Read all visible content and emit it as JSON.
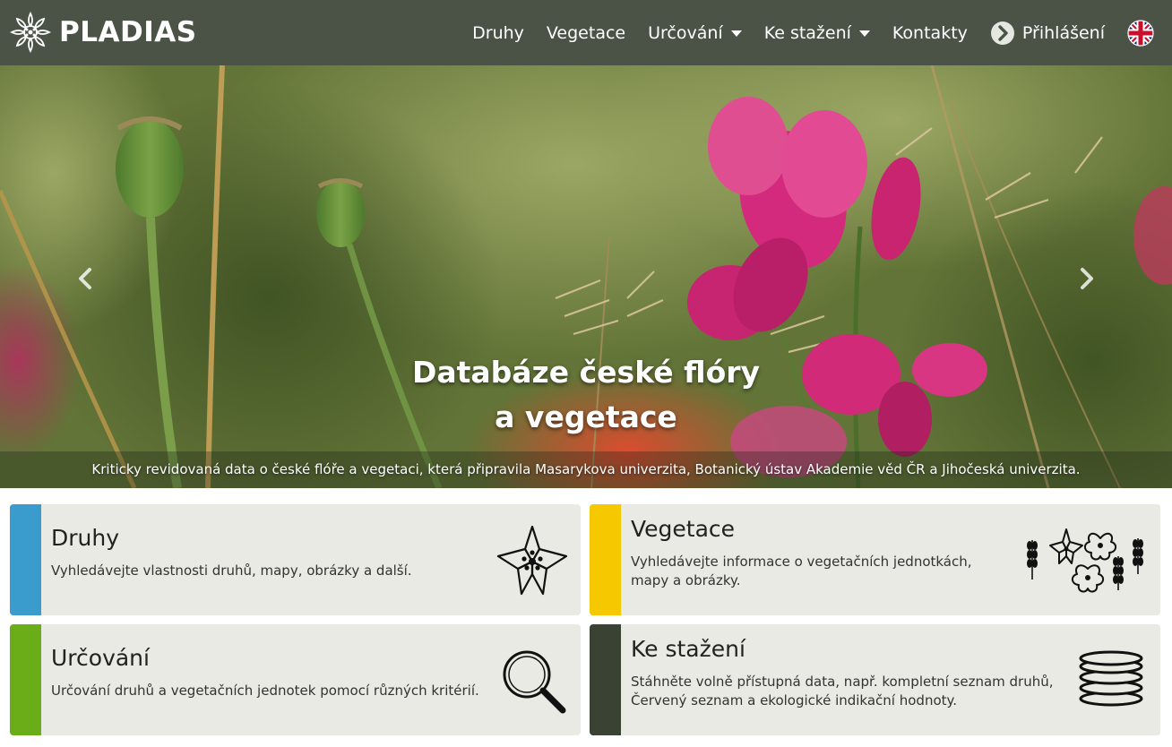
{
  "navbar": {
    "brand_name": "PLADIAS",
    "items": [
      {
        "label": "Druhy"
      },
      {
        "label": "Vegetace"
      },
      {
        "label": "Určování"
      },
      {
        "label": "Ke stažení"
      },
      {
        "label": "Kontakty"
      }
    ],
    "login_label": "Přihlášení",
    "icons": {
      "logo": "flower-logo-icon",
      "login": "login-arrow-icon",
      "language": "uk-flag-icon"
    }
  },
  "hero": {
    "title_line1": "Databáze české flóry",
    "title_line2": "a vegetace",
    "subtitle": "Kriticky revidovaná data o české flóře a vegetaci, která připravila Masarykova univerzita, Botanický ústav Akademie věd ČR a Jihočeská univerzita.",
    "icons": {
      "prev": "chevron-left-icon",
      "next": "chevron-right-icon"
    }
  },
  "cards": {
    "druhy": {
      "title": "Druhy",
      "description": "Vyhledávejte vlastnosti druhů, mapy, obrázky a další.",
      "accent": "#3a9ccd",
      "icon": "flower-icon"
    },
    "vegetace": {
      "title": "Vegetace",
      "description": "Vyhledávejte informace o vegetačních jednotkách, mapy a obrázky.",
      "accent": "#f6c800",
      "icon": "vegetation-icon"
    },
    "urcovani": {
      "title": "Určování",
      "description": "Určování druhů a vegetačních jednotek pomocí různých kritérií.",
      "accent": "#6aad18",
      "icon": "magnifier-icon"
    },
    "ke_stazeni": {
      "title": "Ke stažení",
      "description": "Stáhněte volně přístupná data, např. kompletní seznam druhů, Červený seznam a ekologické indikační hodnoty.",
      "accent": "#3a4234",
      "icon": "database-icon"
    }
  },
  "colors": {
    "navbar": "#4b5347",
    "card_background": "#e8eae3"
  }
}
